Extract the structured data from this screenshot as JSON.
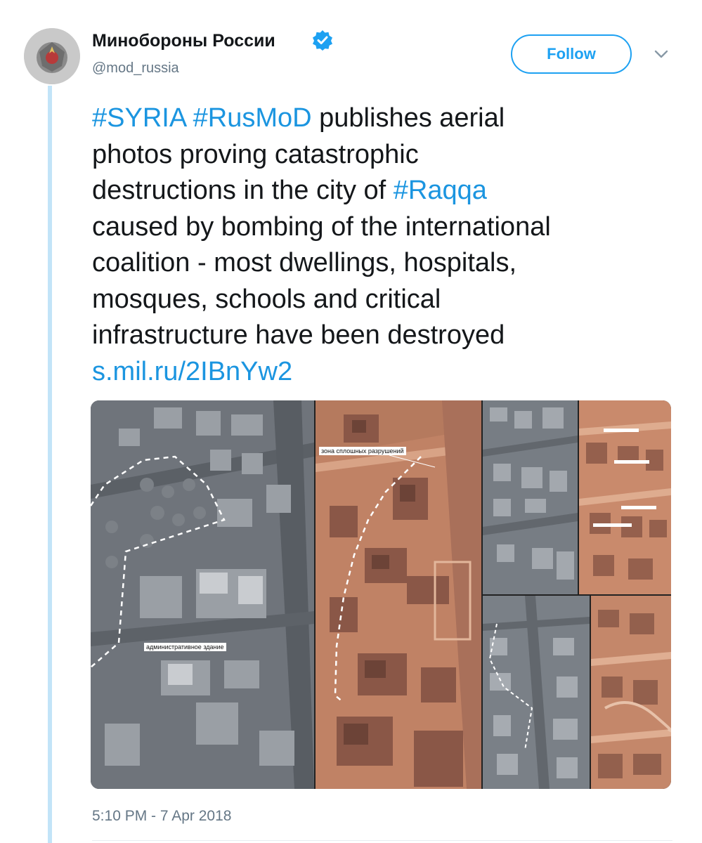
{
  "account": {
    "display_name": "Минобороны России",
    "handle": "@mod_russia",
    "verified": true
  },
  "follow_button": {
    "label": "Follow"
  },
  "tweet": {
    "lines": [
      [
        {
          "type": "hashtag",
          "text": "#SYRIA"
        },
        {
          "type": "text",
          "text": " "
        },
        {
          "type": "hashtag",
          "text": "#RusMoD"
        },
        {
          "type": "text",
          "text": " publishes aerial"
        }
      ],
      [
        {
          "type": "text",
          "text": "photos proving catastrophic"
        }
      ],
      [
        {
          "type": "text",
          "text": "destructions in the city of "
        },
        {
          "type": "hashtag",
          "text": "#Raqqa"
        }
      ],
      [
        {
          "type": "text",
          "text": "caused by bombing of the international"
        }
      ],
      [
        {
          "type": "text",
          "text": "coalition - most dwellings, hospitals,"
        }
      ],
      [
        {
          "type": "text",
          "text": "mosques, schools and critical"
        }
      ],
      [
        {
          "type": "text",
          "text": "infrastructure have been destroyed"
        }
      ],
      [
        {
          "type": "link",
          "text": "s.mil.ru/2IBnYw2"
        }
      ]
    ]
  },
  "media": {
    "panels": [
      {
        "name": "aerial-photo-1",
        "tone": "gray",
        "labels": [
          "административное здание"
        ]
      },
      {
        "name": "aerial-photo-2",
        "tone": "orange",
        "labels": [
          "зона сплошных разрушений"
        ]
      },
      {
        "name": "aerial-photo-3",
        "tone": "gray",
        "labels": []
      },
      {
        "name": "aerial-photo-4",
        "tone": "orange",
        "labels": []
      },
      {
        "name": "aerial-photo-5",
        "tone": "gray",
        "labels": []
      },
      {
        "name": "aerial-photo-6",
        "tone": "orange",
        "labels": []
      }
    ]
  },
  "timestamp": "5:10 PM - 7 Apr 2018",
  "colors": {
    "link": "#1b95e0",
    "follow": "#1da1f2",
    "thread_line": "#c2e4f8",
    "muted": "#657786"
  }
}
